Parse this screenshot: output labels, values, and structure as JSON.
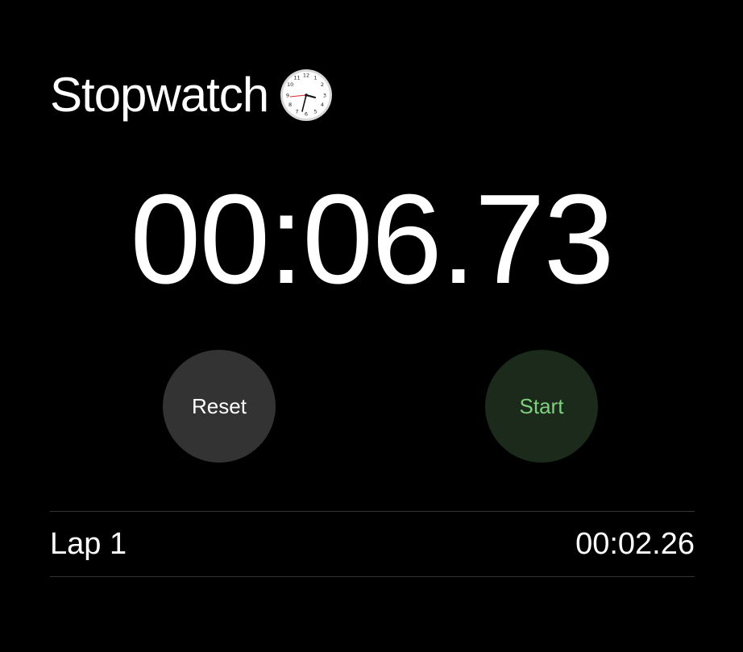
{
  "app": {
    "title": "Stopwatch"
  },
  "display": {
    "time": "00:06.73"
  },
  "buttons": {
    "reset_label": "Reset",
    "start_label": "Start"
  },
  "laps": [
    {
      "label": "Lap 1",
      "time": "00:02.26"
    }
  ],
  "icons": {
    "title_icon": "analog-clock-icon"
  },
  "colors": {
    "background": "#000000",
    "reset_button": "#333333",
    "start_button": "#1b2a1b",
    "start_text": "#7ed07e",
    "divider": "#333333"
  }
}
